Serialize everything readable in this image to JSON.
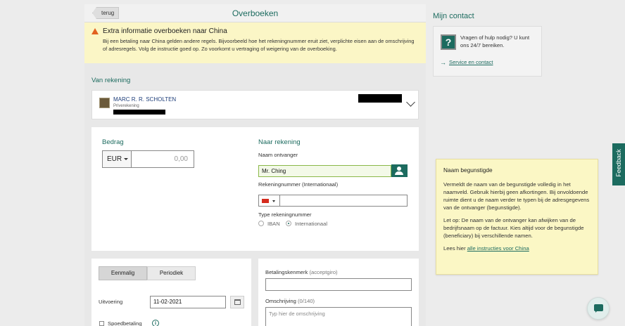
{
  "header": {
    "back_label": "terug",
    "title": "Overboeken"
  },
  "warning": {
    "title": "Extra informatie overboeken naar China",
    "text": "Bij een betaling naar China gelden andere regels. Bijvoorbeeld hoe het rekeningnummer eruit ziet, verplichte eisen aan de omschrijving of adresregels. Volg de instructie goed op. Zo voorkomt u vertraging of weigering van de overboeking."
  },
  "from_account": {
    "section_label": "Van rekening",
    "name": "MARC R. R. SCHOLTEN",
    "type": "Priverekening"
  },
  "amount": {
    "label": "Bedrag",
    "currency": "EUR",
    "value": "0,00"
  },
  "to_account": {
    "section_label": "Naar rekening",
    "recipient_label": "Naam ontvanger",
    "recipient_value": "Mr. Ching",
    "account_number_label": "Rekeningnummer (Internationaal)",
    "account_type_label": "Type rekeningnummer",
    "options": [
      "IBAN",
      "Internationaal"
    ],
    "selected_option": "Internationaal"
  },
  "schedule": {
    "tabs": [
      "Eenmalig",
      "Periodiek"
    ],
    "active_tab": "Eenmalig",
    "execution_label": "Uitvoering",
    "execution_date": "11-02-2021",
    "express_label": "Spoedbetaling"
  },
  "payment_reference": {
    "label": "Betalingskenmerk",
    "hint": "(acceptgiro)"
  },
  "description": {
    "label": "Omschrijving",
    "counter": "(0/140)",
    "placeholder": "Typ hier de omschrijving"
  },
  "contact": {
    "title": "Mijn contact",
    "help_text": "Vragen of hulp nodig? U kunt ons 24/7 bereiken.",
    "link": "Service en contact"
  },
  "tip": {
    "title": "Naam begunstigde",
    "p1": "Vermeldt de naam van de begunstigde volledig in het naamveld. Gebruik hierbij geen afkortingen. Bij onvoldoende ruimte dient u de naam verder te typen bij de adresgegevens van de ontvanger (begunstigde).",
    "p2": "Let op: De naam van de ontvanger kan afwijken van de bedrijfsnaam op de factuur. Kies altijd voor de begunstigde (beneficiary) bij verschillende namen.",
    "p3_prefix": "Lees hier",
    "p3_link": "alle instructies voor China"
  },
  "feedback_label": "Feedback",
  "colors": {
    "accent": "#1c6b5f",
    "warning_bg": "#fbf6c6",
    "warning_icon": "#e2611f",
    "input_valid": "#8ab848"
  }
}
